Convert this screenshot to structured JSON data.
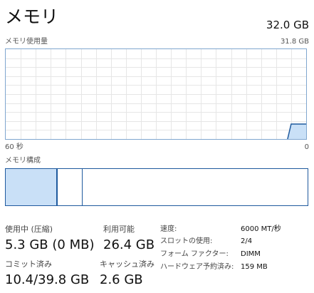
{
  "header": {
    "title": "メモリ",
    "total": "32.0 GB"
  },
  "usage_chart": {
    "label": "メモリ使用量",
    "max_label": "31.8 GB",
    "time_left": "60 秒",
    "time_right": "0",
    "colors": {
      "line": "#1f5a9e",
      "fill": "#c9e0f7",
      "grid": "#e6e6e6",
      "border": "#7fa6cf"
    },
    "series_gb": [
      0,
      0,
      0,
      0,
      0,
      0,
      0,
      0,
      0,
      0,
      0,
      0,
      0,
      0,
      0,
      0,
      0,
      0,
      0,
      0,
      0,
      0,
      0,
      0,
      0,
      0,
      0,
      0,
      0,
      0,
      0,
      0,
      0,
      0,
      0,
      0,
      0,
      0,
      0,
      0,
      0,
      0,
      0,
      0,
      0,
      0,
      0,
      0,
      0,
      0,
      0,
      0,
      0,
      0,
      0,
      0,
      0,
      5.3,
      5.3,
      5.3,
      5.3
    ],
    "max_gb": 31.8
  },
  "composition": {
    "label": "メモリ構成",
    "colors": {
      "in_use": "#c9e0f7",
      "border": "#1f5a9e"
    }
  },
  "stats": {
    "in_use": {
      "label": "使用中 (圧縮)",
      "value": "5.3 GB (0 MB)"
    },
    "available": {
      "label": "利用可能",
      "value": "26.4 GB"
    },
    "committed": {
      "label": "コミット済み",
      "value": "10.4/39.8 GB"
    },
    "cached": {
      "label": "キャッシュ済み",
      "value": "2.6 GB"
    }
  },
  "details": {
    "speed": {
      "label": "速度:",
      "value": "6000 MT/秒"
    },
    "slots": {
      "label": "スロットの使用:",
      "value": "2/4"
    },
    "form_factor": {
      "label": "フォーム ファクター:",
      "value": "DIMM"
    },
    "hw_reserved": {
      "label": "ハードウェア予約済み:",
      "value": "159 MB"
    }
  }
}
